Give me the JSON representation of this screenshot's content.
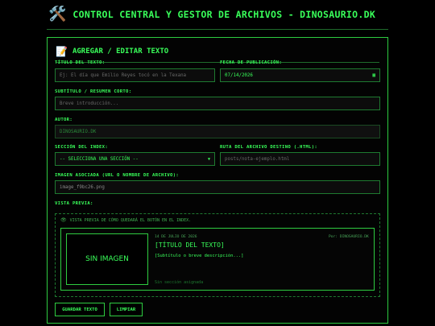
{
  "header": {
    "icon": "tools-icon",
    "title": "CONTROL CENTRAL Y GESTOR DE ARCHIVOS - DINOSAURIO.DK"
  },
  "form": {
    "section_title": "AGREGAR / EDITAR TEXTO",
    "title_label": "TÍTULO DEL TEXTO:",
    "title_placeholder": "Ej: El día que Emilio Reyes tocó en la Texana",
    "date_label": "FECHA DE PUBLICACIÓN:",
    "date_value": "07/14/2026",
    "subtitle_label": "SUBTÍTULO / RESUMEN CORTO:",
    "subtitle_placeholder": "Breve introducción...",
    "author_label": "AUTOR:",
    "author_value": "DINOSAURIO.DK",
    "section_label": "SECCIÓN DEL INDEX:",
    "section_value": "-- SELECCIONA UNA SECCIÓN --",
    "path_label": "RUTA DEL ARCHIVO DESTINO (.HTML):",
    "path_placeholder": "posts/nota-ejemplo.html",
    "image_label": "IMAGEN ASOCIADA (URL O NOMBRE DE ARCHIVO):",
    "image_value": "image_f9bc26.png",
    "preview_label": "VISTA PREVIA:"
  },
  "preview": {
    "note": "VISTA PREVIA DE CÓMO QUEDARÁ EL BOTÓN EN EL INDEX.",
    "no_image": "SIN IMAGEN",
    "date": "14 DE JULIO DE 2026",
    "author": "Por: DINOSAURIO.DK",
    "title": "[TÍTULO DEL TEXTO]",
    "subtitle": "[Subtítulo o breve descripción...]",
    "section": "Sin sección asignada"
  },
  "buttons": {
    "save": "GUARDAR TEXTO",
    "clear": "LIMPIAR"
  },
  "colors": {
    "accent": "#39ff5a",
    "border": "#2ecc40",
    "background": "#000000"
  }
}
